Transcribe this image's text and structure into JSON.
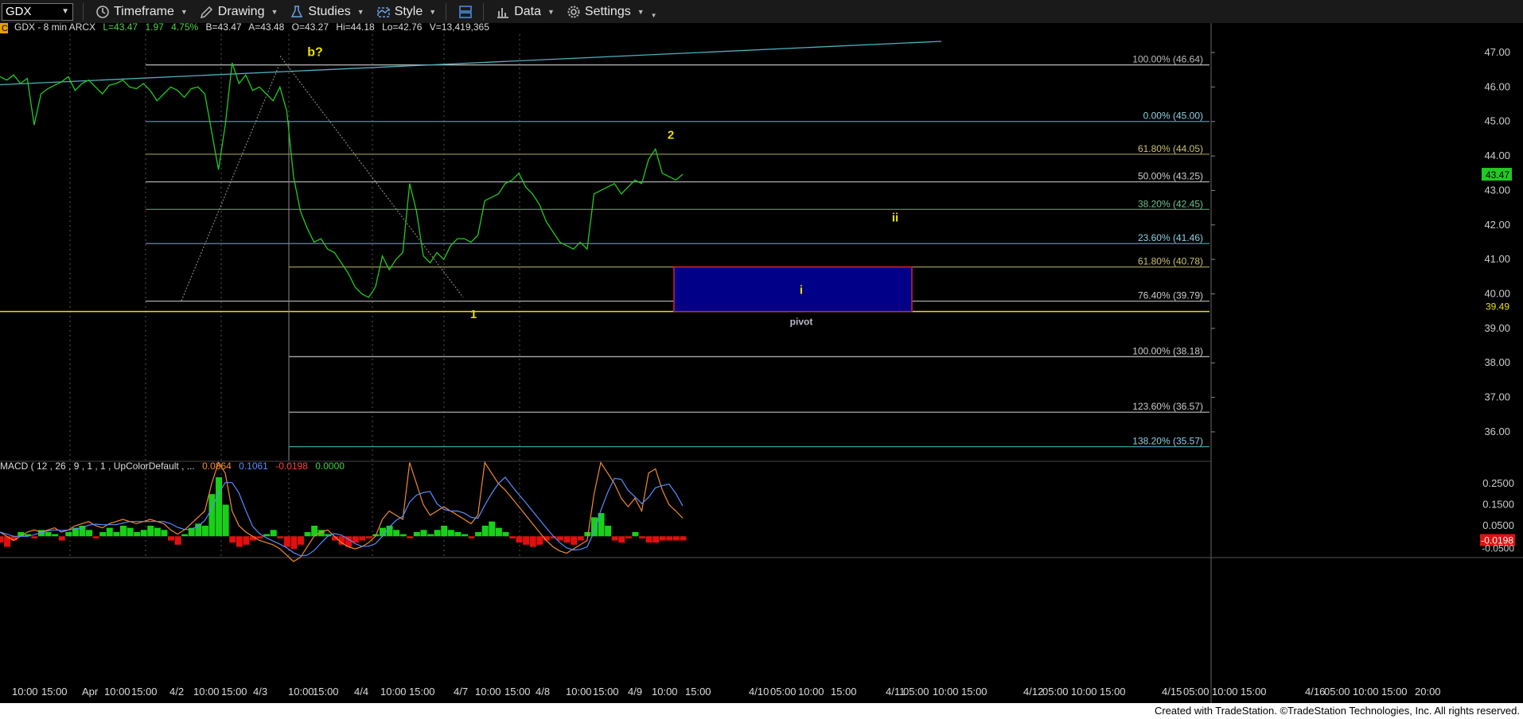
{
  "toolbar": {
    "symbol": "GDX",
    "timeframe_label": "Timeframe",
    "drawing_label": "Drawing",
    "studies_label": "Studies",
    "style_label": "Style",
    "data_label": "Data",
    "settings_label": "Settings",
    "icons": [
      "dropdown-caret-icon",
      "clock-icon",
      "pencil-icon",
      "flask-icon",
      "style-icon",
      "layout-icon",
      "bar-chart-icon",
      "gear-icon"
    ]
  },
  "header": {
    "c_badge": "C",
    "symbol_line": "GDX - 8 min  ARCX",
    "last": "L=43.47",
    "change": "1.97",
    "change_pct": "4.75%",
    "bid": "B=43.47",
    "ask": "A=43.48",
    "open": "O=43.27",
    "high": "Hi=44.18",
    "low": "Lo=42.76",
    "volume": "V=13,419,365"
  },
  "macd_header": {
    "label": "MACD ( 12 , 26 , 9 , 1 , 1 , UpColorDefault , ...",
    "v1": "0.0864",
    "v2": "0.1061",
    "v3": "-0.0198",
    "v4": "0.0000"
  },
  "chart_data": {
    "type": "line",
    "title": "GDX - 8 min",
    "ylim": [
      35.3,
      47.6
    ],
    "price_ticks": [
      47.0,
      46.0,
      45.0,
      44.0,
      43.0,
      42.0,
      41.0,
      40.0,
      39.0,
      38.0,
      37.0,
      36.0
    ],
    "price_tick_labels": [
      "47.00",
      "46.00",
      "45.00",
      "44.00",
      "43.00",
      "42.00",
      "41.00",
      "40.00",
      "39.00",
      "38.00",
      "37.00",
      "36.00"
    ],
    "last_price_label": "43.47",
    "pivot_price_label": "39.49",
    "macd_ticks": [
      0.25,
      0.15,
      0.05
    ],
    "macd_tick_labels": [
      "0.2500",
      "0.1500",
      "0.0500"
    ],
    "macd_current_label": "-0.0198",
    "macd_low_label": "-0.0500",
    "x_labels": [
      "10:00",
      "15:00",
      "Apr",
      "10:00",
      "15:00",
      "4/2",
      "10:00",
      "15:00",
      "4/3",
      "10:00",
      "15:00",
      "4/4",
      "10:00",
      "15:00",
      "4/7",
      "10:00",
      "15:00",
      "4/8",
      "10:00",
      "15:00",
      "4/9",
      "10:00",
      "15:00",
      "4/10",
      "05:00",
      "10:00",
      "15:00",
      "4/11",
      "05:00",
      "10:00",
      "15:00",
      "4/12",
      "05:00",
      "10:00",
      "15:00",
      "4/15",
      "05:00",
      "10:00",
      "15:00",
      "4/16",
      "05:00",
      "10:00",
      "15:00",
      "20:00"
    ],
    "fib_labels": [
      {
        "text": "100.00% (46.64)",
        "price": 46.64
      },
      {
        "text": "0.00% (45.00)",
        "price": 45.0
      },
      {
        "text": "61.80% (44.05)",
        "price": 44.05
      },
      {
        "text": "50.00% (43.25)",
        "price": 43.25
      },
      {
        "text": "38.20% (42.45)",
        "price": 42.45
      },
      {
        "text": "23.60% (41.46)",
        "price": 41.46
      },
      {
        "text": "61.80% (40.78)",
        "price": 40.78
      },
      {
        "text": "76.40% (39.79)",
        "price": 39.79
      },
      {
        "text": "100.00% (38.18)",
        "price": 38.18
      },
      {
        "text": "123.60% (36.57)",
        "price": 36.57
      },
      {
        "text": "138.20% (35.57)",
        "price": 35.57
      }
    ],
    "annotations": [
      {
        "text": "b?",
        "price": 46.9
      },
      {
        "text": "2",
        "price": 44.5
      },
      {
        "text": "ii",
        "price": 42.1
      },
      {
        "text": "i",
        "price": 40.0
      },
      {
        "text": "pivot",
        "price": 39.1
      },
      {
        "text": "1",
        "price": 39.3
      }
    ],
    "pivot_box": {
      "top": 40.78,
      "bottom": 39.49
    },
    "series": [
      {
        "values": [
          46.3,
          46.2,
          46.35,
          46.1,
          46.25,
          44.9,
          45.8,
          45.95,
          46.05,
          46.15,
          46.3,
          45.9,
          46.1,
          46.2,
          46.0,
          45.8,
          46.05,
          46.1,
          46.2,
          46.0,
          45.95,
          46.1,
          45.9,
          45.6,
          45.8,
          46.0,
          45.9,
          45.7,
          45.95,
          46.0,
          45.8,
          44.7,
          43.6,
          44.9,
          46.7,
          46.1,
          46.35,
          45.9,
          46.0,
          45.8,
          45.6,
          46.0,
          45.3,
          43.4,
          42.4,
          41.9,
          41.5,
          41.6,
          41.3,
          41.2,
          40.9,
          40.6,
          40.2,
          40.0,
          39.9,
          40.2,
          41.1,
          40.7,
          41.0,
          41.2,
          43.2,
          42.4,
          41.1,
          40.9,
          41.2,
          41.0,
          41.4,
          41.6,
          41.6,
          41.5,
          41.7,
          42.7,
          42.8,
          42.9,
          43.2,
          43.3,
          43.5,
          43.1,
          42.9,
          42.6,
          42.1,
          41.8,
          41.5,
          41.4,
          41.3,
          41.5,
          41.3,
          42.9,
          43.0,
          43.1,
          43.2,
          42.9,
          43.1,
          43.3,
          43.2,
          43.9,
          44.2,
          43.5,
          43.4,
          43.3,
          43.47
        ]
      },
      {
        "name": "MACD histogram",
        "values": [
          -0.03,
          -0.05,
          -0.02,
          0.02,
          0.01,
          -0.01,
          0.03,
          0.02,
          0.01,
          -0.02,
          0.02,
          0.04,
          0.05,
          0.03,
          -0.01,
          0.02,
          0.04,
          0.02,
          0.05,
          0.04,
          0.02,
          0.03,
          0.05,
          0.04,
          0.03,
          -0.02,
          -0.04,
          0.01,
          0.04,
          0.06,
          0.05,
          0.2,
          0.28,
          0.15,
          -0.03,
          -0.05,
          -0.04,
          -0.02,
          -0.01,
          0.01,
          0.03,
          -0.01,
          -0.05,
          -0.06,
          -0.04,
          0.02,
          0.05,
          0.03,
          0.01,
          -0.02,
          -0.04,
          -0.05,
          -0.03,
          -0.02,
          -0.01,
          0.01,
          0.04,
          0.05,
          0.03,
          0.01,
          -0.01,
          0.02,
          0.03,
          0.01,
          0.03,
          0.05,
          0.03,
          0.02,
          0.01,
          -0.01,
          0.02,
          0.05,
          0.07,
          0.04,
          0.02,
          -0.01,
          -0.03,
          -0.04,
          -0.05,
          -0.04,
          -0.02,
          -0.01,
          -0.02,
          -0.03,
          -0.04,
          -0.02,
          0.02,
          0.09,
          0.11,
          0.05,
          -0.02,
          -0.03,
          -0.01,
          0.02,
          -0.01,
          -0.03,
          -0.03,
          -0.02,
          -0.02,
          -0.02,
          -0.0198
        ]
      },
      {
        "name": "MACD",
        "values": [
          0.02,
          0.0,
          -0.02,
          0.0,
          0.02,
          0.03,
          0.02,
          0.03,
          0.04,
          0.02,
          0.03,
          0.05,
          0.06,
          0.07,
          0.05,
          0.04,
          0.06,
          0.07,
          0.08,
          0.07,
          0.06,
          0.07,
          0.08,
          0.07,
          0.06,
          0.03,
          0.01,
          0.03,
          0.06,
          0.09,
          0.12,
          0.25,
          0.35,
          0.3,
          0.12,
          0.05,
          0.02,
          0.0,
          -0.02,
          -0.03,
          -0.04,
          -0.06,
          -0.09,
          -0.12,
          -0.1,
          -0.05,
          0.0,
          0.02,
          0.03,
          0.0,
          -0.03,
          -0.05,
          -0.06,
          -0.05,
          -0.03,
          0.0,
          0.08,
          0.12,
          0.1,
          0.08,
          0.35,
          0.25,
          0.15,
          0.1,
          0.12,
          0.14,
          0.12,
          0.1,
          0.08,
          0.06,
          0.1,
          0.35,
          0.3,
          0.25,
          0.22,
          0.18,
          0.14,
          0.1,
          0.06,
          0.02,
          -0.02,
          -0.05,
          -0.07,
          -0.08,
          -0.06,
          -0.04,
          -0.02,
          0.2,
          0.35,
          0.3,
          0.25,
          0.18,
          0.14,
          0.18,
          0.12,
          0.3,
          0.32,
          0.22,
          0.15,
          0.12,
          0.0864
        ]
      }
    ]
  },
  "footer": {
    "credit": "Created with TradeStation. ©TradeStation Technologies, Inc. All rights reserved."
  }
}
